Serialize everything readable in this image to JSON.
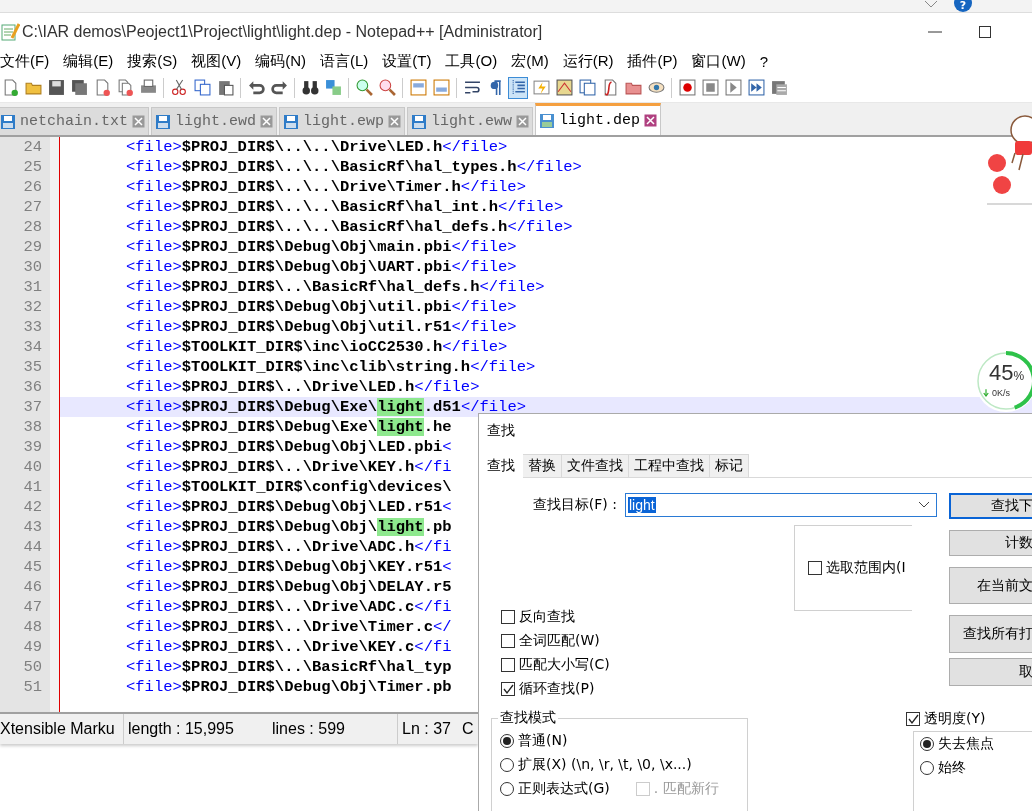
{
  "top_strip": {
    "help": "?"
  },
  "window": {
    "title": "C:\\IAR demos\\Peoject1\\Project\\light\\light.dep - Notepad++ [Administrator]"
  },
  "menu": [
    "文件(F)",
    "编辑(E)",
    "搜索(S)",
    "视图(V)",
    "编码(N)",
    "语言(L)",
    "设置(T)",
    "工具(O)",
    "宏(M)",
    "运行(R)",
    "插件(P)",
    "窗口(W)",
    "?"
  ],
  "toolbar": {
    "groups": [
      [
        {
          "pressed": false
        },
        {
          "pressed": false
        },
        {
          "pressed": false
        },
        {
          "pressed": false
        },
        {
          "pressed": false
        },
        {
          "pressed": false
        },
        {
          "pressed": false
        }
      ],
      [
        {
          "pressed": false
        },
        {
          "pressed": false
        },
        {
          "pressed": false
        }
      ],
      [
        {
          "pressed": false
        },
        {
          "pressed": false
        }
      ],
      [
        {
          "pressed": false
        },
        {
          "pressed": false
        }
      ],
      [
        {
          "pressed": false
        },
        {
          "pressed": false
        }
      ],
      [
        {
          "pressed": false
        },
        {
          "pressed": false
        }
      ],
      [
        {
          "pressed": false
        },
        {
          "pressed": false
        },
        {
          "pressed": true
        },
        {
          "pressed": false
        },
        {
          "pressed": false
        },
        {
          "pressed": false
        },
        {
          "pressed": false
        },
        {
          "pressed": false
        },
        {
          "pressed": false
        }
      ],
      [
        {
          "pressed": false
        },
        {
          "pressed": false
        },
        {
          "pressed": false
        },
        {
          "pressed": false
        },
        {
          "pressed": false
        }
      ]
    ]
  },
  "tabs": [
    {
      "label": "netchain.txt",
      "selected": false
    },
    {
      "label": "light.ewd",
      "selected": false
    },
    {
      "label": "light.ewp",
      "selected": false
    },
    {
      "label": "light.eww",
      "selected": false
    },
    {
      "label": "light.dep",
      "selected": true
    }
  ],
  "editor": {
    "lines": [
      {
        "number": "24",
        "current": false,
        "parts": [
          {
            "kind": "tag",
            "text": "<file>"
          },
          {
            "kind": "text",
            "text": "$PROJ_DIR$\\..\\..\\Drive\\LED.h"
          },
          {
            "kind": "tag",
            "text": "</file>"
          }
        ]
      },
      {
        "number": "25",
        "current": false,
        "parts": [
          {
            "kind": "tag",
            "text": "<file>"
          },
          {
            "kind": "text",
            "text": "$PROJ_DIR$\\..\\..\\BasicRf\\hal_types.h"
          },
          {
            "kind": "tag",
            "text": "</file>"
          }
        ]
      },
      {
        "number": "26",
        "current": false,
        "parts": [
          {
            "kind": "tag",
            "text": "<file>"
          },
          {
            "kind": "text",
            "text": "$PROJ_DIR$\\..\\..\\Drive\\Timer.h"
          },
          {
            "kind": "tag",
            "text": "</file>"
          }
        ]
      },
      {
        "number": "27",
        "current": false,
        "parts": [
          {
            "kind": "tag",
            "text": "<file>"
          },
          {
            "kind": "text",
            "text": "$PROJ_DIR$\\..\\..\\BasicRf\\hal_int.h"
          },
          {
            "kind": "tag",
            "text": "</file>"
          }
        ]
      },
      {
        "number": "28",
        "current": false,
        "parts": [
          {
            "kind": "tag",
            "text": "<file>"
          },
          {
            "kind": "text",
            "text": "$PROJ_DIR$\\..\\..\\BasicRf\\hal_defs.h"
          },
          {
            "kind": "tag",
            "text": "</file>"
          }
        ]
      },
      {
        "number": "29",
        "current": false,
        "parts": [
          {
            "kind": "tag",
            "text": "<file>"
          },
          {
            "kind": "text",
            "text": "$PROJ_DIR$\\Debug\\Obj\\main.pbi"
          },
          {
            "kind": "tag",
            "text": "</file>"
          }
        ]
      },
      {
        "number": "30",
        "current": false,
        "parts": [
          {
            "kind": "tag",
            "text": "<file>"
          },
          {
            "kind": "text",
            "text": "$PROJ_DIR$\\Debug\\Obj\\UART.pbi"
          },
          {
            "kind": "tag",
            "text": "</file>"
          }
        ]
      },
      {
        "number": "31",
        "current": false,
        "parts": [
          {
            "kind": "tag",
            "text": "<file>"
          },
          {
            "kind": "text",
            "text": "$PROJ_DIR$\\..\\BasicRf\\hal_defs.h"
          },
          {
            "kind": "tag",
            "text": "</file>"
          }
        ]
      },
      {
        "number": "32",
        "current": false,
        "parts": [
          {
            "kind": "tag",
            "text": "<file>"
          },
          {
            "kind": "text",
            "text": "$PROJ_DIR$\\Debug\\Obj\\util.pbi"
          },
          {
            "kind": "tag",
            "text": "</file>"
          }
        ]
      },
      {
        "number": "33",
        "current": false,
        "parts": [
          {
            "kind": "tag",
            "text": "<file>"
          },
          {
            "kind": "text",
            "text": "$PROJ_DIR$\\Debug\\Obj\\util.r51"
          },
          {
            "kind": "tag",
            "text": "</file>"
          }
        ]
      },
      {
        "number": "34",
        "current": false,
        "parts": [
          {
            "kind": "tag",
            "text": "<file>"
          },
          {
            "kind": "text",
            "text": "$TOOLKIT_DIR$\\inc\\ioCC2530.h"
          },
          {
            "kind": "tag",
            "text": "</file>"
          }
        ]
      },
      {
        "number": "35",
        "current": false,
        "parts": [
          {
            "kind": "tag",
            "text": "<file>"
          },
          {
            "kind": "text",
            "text": "$TOOLKIT_DIR$\\inc\\clib\\string.h"
          },
          {
            "kind": "tag",
            "text": "</file>"
          }
        ]
      },
      {
        "number": "36",
        "current": false,
        "parts": [
          {
            "kind": "tag",
            "text": "<file>"
          },
          {
            "kind": "text",
            "text": "$PROJ_DIR$\\..\\Drive\\LED.h"
          },
          {
            "kind": "tag",
            "text": "</file>"
          }
        ]
      },
      {
        "number": "37",
        "current": true,
        "parts": [
          {
            "kind": "tag",
            "text": "<file>"
          },
          {
            "kind": "text",
            "text": "$PROJ_DIR$\\Debug\\Exe\\"
          },
          {
            "kind": "match",
            "text": "light"
          },
          {
            "kind": "text",
            "text": ".d51"
          },
          {
            "kind": "tag",
            "text": "</file>"
          }
        ]
      },
      {
        "number": "38",
        "current": false,
        "parts": [
          {
            "kind": "tag",
            "text": "<file>"
          },
          {
            "kind": "text",
            "text": "$PROJ_DIR$\\Debug\\Exe\\"
          },
          {
            "kind": "match",
            "text": "light"
          },
          {
            "kind": "text",
            "text": ".he"
          }
        ]
      },
      {
        "number": "39",
        "current": false,
        "parts": [
          {
            "kind": "tag",
            "text": "<file>"
          },
          {
            "kind": "text",
            "text": "$PROJ_DIR$\\Debug\\Obj\\LED.pbi"
          },
          {
            "kind": "tag",
            "text": "<"
          }
        ]
      },
      {
        "number": "40",
        "current": false,
        "parts": [
          {
            "kind": "tag",
            "text": "<file>"
          },
          {
            "kind": "text",
            "text": "$PROJ_DIR$\\..\\Drive\\KEY.h"
          },
          {
            "kind": "tag",
            "text": "</fi"
          }
        ]
      },
      {
        "number": "41",
        "current": false,
        "parts": [
          {
            "kind": "tag",
            "text": "<file>"
          },
          {
            "kind": "text",
            "text": "$TOOLKIT_DIR$\\config\\devices\\"
          }
        ]
      },
      {
        "number": "42",
        "current": false,
        "parts": [
          {
            "kind": "tag",
            "text": "<file>"
          },
          {
            "kind": "text",
            "text": "$PROJ_DIR$\\Debug\\Obj\\LED.r51"
          },
          {
            "kind": "tag",
            "text": "<"
          }
        ]
      },
      {
        "number": "43",
        "current": false,
        "parts": [
          {
            "kind": "tag",
            "text": "<file>"
          },
          {
            "kind": "text",
            "text": "$PROJ_DIR$\\Debug\\Obj\\"
          },
          {
            "kind": "match",
            "text": "light"
          },
          {
            "kind": "text",
            "text": ".pb"
          }
        ]
      },
      {
        "number": "44",
        "current": false,
        "parts": [
          {
            "kind": "tag",
            "text": "<file>"
          },
          {
            "kind": "text",
            "text": "$PROJ_DIR$\\..\\Drive\\ADC.h"
          },
          {
            "kind": "tag",
            "text": "</fi"
          }
        ]
      },
      {
        "number": "45",
        "current": false,
        "parts": [
          {
            "kind": "tag",
            "text": "<file>"
          },
          {
            "kind": "text",
            "text": "$PROJ_DIR$\\Debug\\Obj\\KEY.r51"
          },
          {
            "kind": "tag",
            "text": "<"
          }
        ]
      },
      {
        "number": "46",
        "current": false,
        "parts": [
          {
            "kind": "tag",
            "text": "<file>"
          },
          {
            "kind": "text",
            "text": "$PROJ_DIR$\\Debug\\Obj\\DELAY.r5"
          }
        ]
      },
      {
        "number": "47",
        "current": false,
        "parts": [
          {
            "kind": "tag",
            "text": "<file>"
          },
          {
            "kind": "text",
            "text": "$PROJ_DIR$\\..\\Drive\\ADC.c"
          },
          {
            "kind": "tag",
            "text": "</fi"
          }
        ]
      },
      {
        "number": "48",
        "current": false,
        "parts": [
          {
            "kind": "tag",
            "text": "<file>"
          },
          {
            "kind": "text",
            "text": "$PROJ_DIR$\\..\\Drive\\Timer.c"
          },
          {
            "kind": "tag",
            "text": "</"
          }
        ]
      },
      {
        "number": "49",
        "current": false,
        "parts": [
          {
            "kind": "tag",
            "text": "<file>"
          },
          {
            "kind": "text",
            "text": "$PROJ_DIR$\\..\\Drive\\KEY.c"
          },
          {
            "kind": "tag",
            "text": "</fi"
          }
        ]
      },
      {
        "number": "50",
        "current": false,
        "parts": [
          {
            "kind": "tag",
            "text": "<file>"
          },
          {
            "kind": "text",
            "text": "$PROJ_DIR$\\..\\BasicRf\\hal_typ"
          }
        ]
      },
      {
        "number": "51",
        "current": false,
        "parts": [
          {
            "kind": "tag",
            "text": "<file>"
          },
          {
            "kind": "text",
            "text": "$PROJ_DIR$\\Debug\\Obj\\Timer.pb"
          }
        ]
      }
    ]
  },
  "status_bar": [
    "Xtensible Marku",
    "length : 15,995",
    "lines : 599",
    "Ln : 37",
    "C"
  ],
  "speed_widget": {
    "percent": "45",
    "unit": "%",
    "rate": "0K/s",
    "level": 0.45
  },
  "find_dialog": {
    "title": "查找",
    "tabs": [
      {
        "label": "查找",
        "selected": true
      },
      {
        "label": "替换",
        "selected": false
      },
      {
        "label": "文件查找",
        "selected": false
      },
      {
        "label": "工程中查找",
        "selected": false
      },
      {
        "label": "标记",
        "selected": false
      }
    ],
    "find_label": "查找目标(F) :",
    "find_value": "light",
    "in_selection": {
      "label": "选取范围内(I",
      "checked": false
    },
    "options": [
      {
        "label": "反向查找",
        "checked": false
      },
      {
        "label": "全词匹配(W)",
        "checked": false
      },
      {
        "label": "匹配大小写(C)",
        "checked": false
      },
      {
        "label": "循环查找(P)",
        "checked": true
      }
    ],
    "buttons": [
      "查找下",
      "计数",
      "在当前文",
      "查找所有打",
      "取"
    ],
    "search_mode": {
      "title": "查找模式",
      "modes": [
        {
          "label": "普通(N)",
          "selected": true
        },
        {
          "label": "扩展(X) (\\n, \\r, \\t, \\0, \\x...)",
          "selected": false
        },
        {
          "label": "正则表达式(G)",
          "selected": false
        }
      ],
      "dot_newline": {
        "label": ". 匹配新行",
        "checked": false,
        "disabled": true
      }
    },
    "transparency": {
      "label": "透明度(Y)",
      "checked": true,
      "modes": [
        {
          "label": "失去焦点",
          "selected": true
        },
        {
          "label": "始终",
          "selected": false
        }
      ]
    }
  }
}
